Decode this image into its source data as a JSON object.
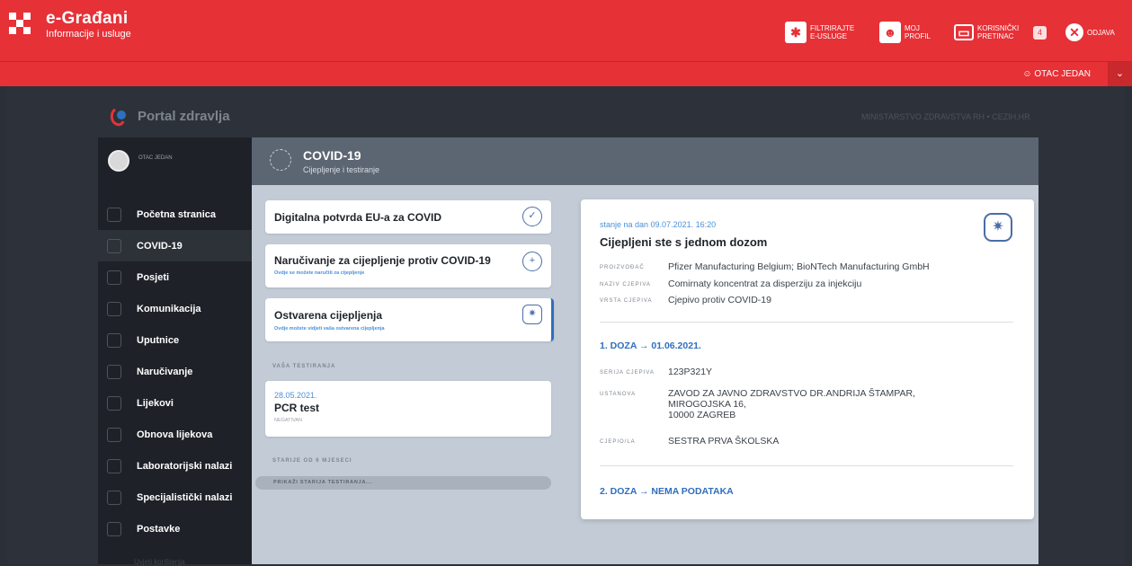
{
  "topbar": {
    "brand_title": "e-Građani",
    "brand_sub": "Informacije i usluge",
    "filter_label": "FILTRIRAJTE E-USLUGE",
    "profile_label": "MOJ PROFIL",
    "inbox_label": "KORISNIČKI PRETINAC",
    "inbox_count": "4",
    "logout_label": "ODJAVA"
  },
  "userbar": {
    "user_name": "OTAC JEDAN",
    "dropdown_icon": "chevron-down"
  },
  "portal": {
    "title": "Portal zdravlja",
    "ministry": "MINISTARSTVO ZDRAVSTVA RH • CEZIH.HR"
  },
  "sidebar": {
    "profile_name": "OTAC JEDAN",
    "items": [
      {
        "label": "Početna stranica",
        "icon": "pulse-icon"
      },
      {
        "label": "COVID-19",
        "icon": "virus-icon"
      },
      {
        "label": "Posjeti",
        "icon": "home-icon"
      },
      {
        "label": "Komunikacija",
        "icon": "chat-icon"
      },
      {
        "label": "Uputnice",
        "icon": "document-icon"
      },
      {
        "label": "Naručivanje",
        "icon": "calendar-icon"
      },
      {
        "label": "Lijekovi",
        "icon": "pill-icon"
      },
      {
        "label": "Obnova lijekova",
        "icon": "renew-icon"
      },
      {
        "label": "Laboratorijski nalazi",
        "icon": "flask-icon"
      },
      {
        "label": "Specijalistički nalazi",
        "icon": "doctor-icon"
      },
      {
        "label": "Postavke",
        "icon": "gear-icon"
      }
    ],
    "active_index": 1,
    "footer": "Uvjeti korištenja"
  },
  "header": {
    "title": "COVID-19",
    "subtitle": "Cijepljenje i testiranje"
  },
  "cards": {
    "eu_cert": {
      "title": "Digitalna potvrda EU-a za COVID"
    },
    "booking": {
      "title": "Naručivanje za cijepljenje protiv COVID-19",
      "subtitle": "Ovdje se možete naručiti za cijepljenje"
    },
    "vaccinations": {
      "title": "Ostvarena cijepljenja",
      "subtitle": "Ovdje možete vidjeti vaša ostvarena cijepljenja"
    }
  },
  "testing": {
    "section_label": "VAŠA TESTIRANJA",
    "tests": [
      {
        "date": "28.05.2021.",
        "name": "PCR test",
        "result": "NEGATIVAN"
      }
    ],
    "older_label": "STARIJE OD 6 MJESECI",
    "older_button": "PRIKAŽI STARIJA TESTIRANJA..."
  },
  "detail": {
    "date": "stanje na dan 09.07.2021. 16:20",
    "title": "Cijepljeni ste s jednom dozom",
    "fields": [
      {
        "key": "PROIZVOĐAČ",
        "value": "Pfizer Manufacturing Belgium; BioNTech Manufacturing GmbH"
      },
      {
        "key": "NAZIV CJEPIVA",
        "value": "Comirnaty koncentrat za disperziju za injekciju"
      },
      {
        "key": "VRSTA CJEPIVA",
        "value": "Cjepivo protiv COVID-19"
      }
    ],
    "dose1": {
      "heading": "1. DOZA → 01.06.2021.",
      "fields": [
        {
          "key": "SERIJA CJEPIVA",
          "value": "123P321Y"
        },
        {
          "key": "USTANOVA",
          "value": "ZAVOD ZA JAVNO ZDRAVSTVO DR.ANDRIJA ŠTAMPAR,\nMIROGOJSKA 16,\n10000 ZAGREB"
        },
        {
          "key": "CJEPIO/LA",
          "value": "SESTRA PRVA ŠKOLSKA"
        }
      ]
    },
    "dose2": {
      "heading": "2. DOZA → NEMA PODATAKA"
    }
  },
  "colors": {
    "brand_red": "#e63137",
    "accent_blue": "#2e6fbf",
    "active_bar": "#2e6fbf"
  }
}
